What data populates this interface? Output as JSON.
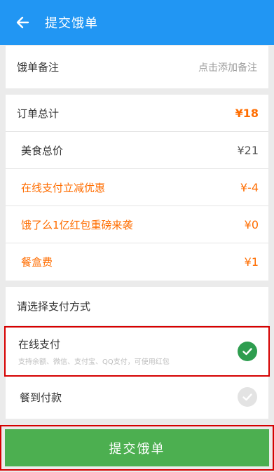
{
  "header": {
    "title": "提交饿单",
    "back_icon": "arrow-left-icon"
  },
  "remark": {
    "label": "饿单备注",
    "action": "点击添加备注"
  },
  "order_total": {
    "label": "订单总计",
    "value": "¥18",
    "items": [
      {
        "label": "美食总价",
        "value": "¥21",
        "highlight": false
      },
      {
        "label": "在线支付立减优惠",
        "value": "¥-4",
        "highlight": true
      },
      {
        "label": "饿了么1亿红包重磅来袭",
        "value": "¥0",
        "highlight": true
      },
      {
        "label": "餐盒费",
        "value": "¥1",
        "highlight": true
      }
    ]
  },
  "payment": {
    "title": "请选择支付方式",
    "options": [
      {
        "title": "在线支付",
        "desc": "支持余额、微信、支付宝、QQ支付，可使用红包",
        "selected": true
      },
      {
        "title": "餐到付款",
        "desc": "",
        "selected": false
      }
    ]
  },
  "submit": {
    "label": "提交饿单"
  },
  "colors": {
    "header": "#2196f3",
    "accent": "#ff6d00",
    "submit": "#4caf50",
    "check": "#2e9d4f",
    "highlight_border": "#d50000"
  }
}
